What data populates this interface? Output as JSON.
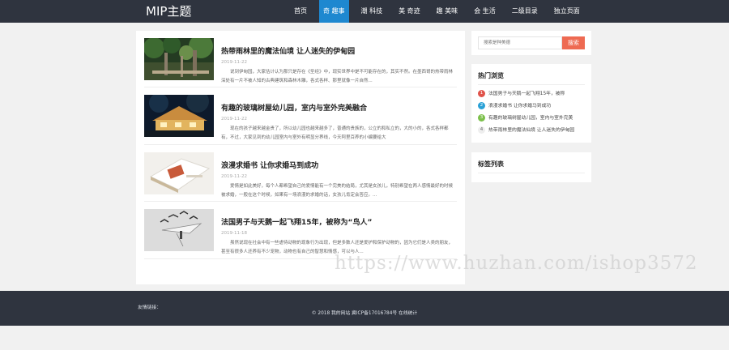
{
  "header": {
    "logo": "MIP主题",
    "nav": [
      {
        "label": "首页",
        "active": false
      },
      {
        "label": "奇 趣事",
        "active": true
      },
      {
        "label": "潮 科技",
        "active": false
      },
      {
        "label": "美 奇迹",
        "active": false
      },
      {
        "label": "趣 美味",
        "active": false
      },
      {
        "label": "会 生活",
        "active": false
      },
      {
        "label": "二级目录",
        "active": false
      },
      {
        "label": "独立页面",
        "active": false
      }
    ]
  },
  "articles": [
    {
      "title": "热带雨林里的魔法仙境 让人迷失的伊甸园",
      "date": "2019-11-22",
      "excerpt": "说到伊甸园，大家估计认为那只是存在《圣经》中，现实世界中是不可能存在的，其实不然。在墨西哥的热带雨林深处有一片不被人知的古典建筑和森林木雕，各式各样、那里就像一片自然..."
    },
    {
      "title": "有趣的玻璃树屋幼儿园，室内与室外完美融合",
      "date": "2019-11-22",
      "excerpt": "现在的孩子越来越金贵了，所以幼儿园也越来越多了，普通的贵族的，公立的和私立的，大的小的，各式各样都有，不过，大家见到的幼儿园室内与室外有明显分界线，今天阿里百养的小编要给大"
    },
    {
      "title": "浪漫求婚书 让你求婚马到成功",
      "date": "2019-11-22",
      "excerpt": "爱情是如此美好，每个人都希望自己的爱情能有一个完美的结局，尤其是女孩儿，特别希望在两人感情最好的时候被求婚，一般在这个时候，如果有一场浪漫的求婚的话，女孩儿肯定会答应。..."
    },
    {
      "title": "法国男子与天鹅一起飞翔15年，被称为“鸟人”",
      "date": "2019-11-18",
      "excerpt": "虽然说现在社会中有一些虐待动物的现象行为出现，但是多数人还是爱护和保护动物的，因为它们是人类的朋友，甚至有很多人还养有不少宠物，动物也有自己的智慧和情感，可以与人..."
    }
  ],
  "sidebar": {
    "search": {
      "placeholder": "搜索是种美德",
      "button": "搜索"
    },
    "hot": {
      "title": "热门浏览",
      "items": [
        {
          "num": "1",
          "text": "法国男子与天鹅一起飞翔15年，被称",
          "color": "#e0534a"
        },
        {
          "num": "2",
          "text": "浪漫求婚书 让你求婚马到成功",
          "color": "#2aa1d6"
        },
        {
          "num": "3",
          "text": "有趣的玻璃树屋幼儿园，室内与室外完美",
          "color": "#7cc04b"
        },
        {
          "num": "4",
          "text": "热带雨林里的魔法仙境 让人迷失的伊甸园",
          "color": "#eeeeee"
        }
      ]
    },
    "tags": {
      "title": "标签列表"
    }
  },
  "footer": {
    "friend_links": "友情链接：",
    "copyright": "© 2018 我的网站 冀ICP备17016784号  在线统计"
  },
  "watermark": "https://www.huzhan.com/ishop3572"
}
